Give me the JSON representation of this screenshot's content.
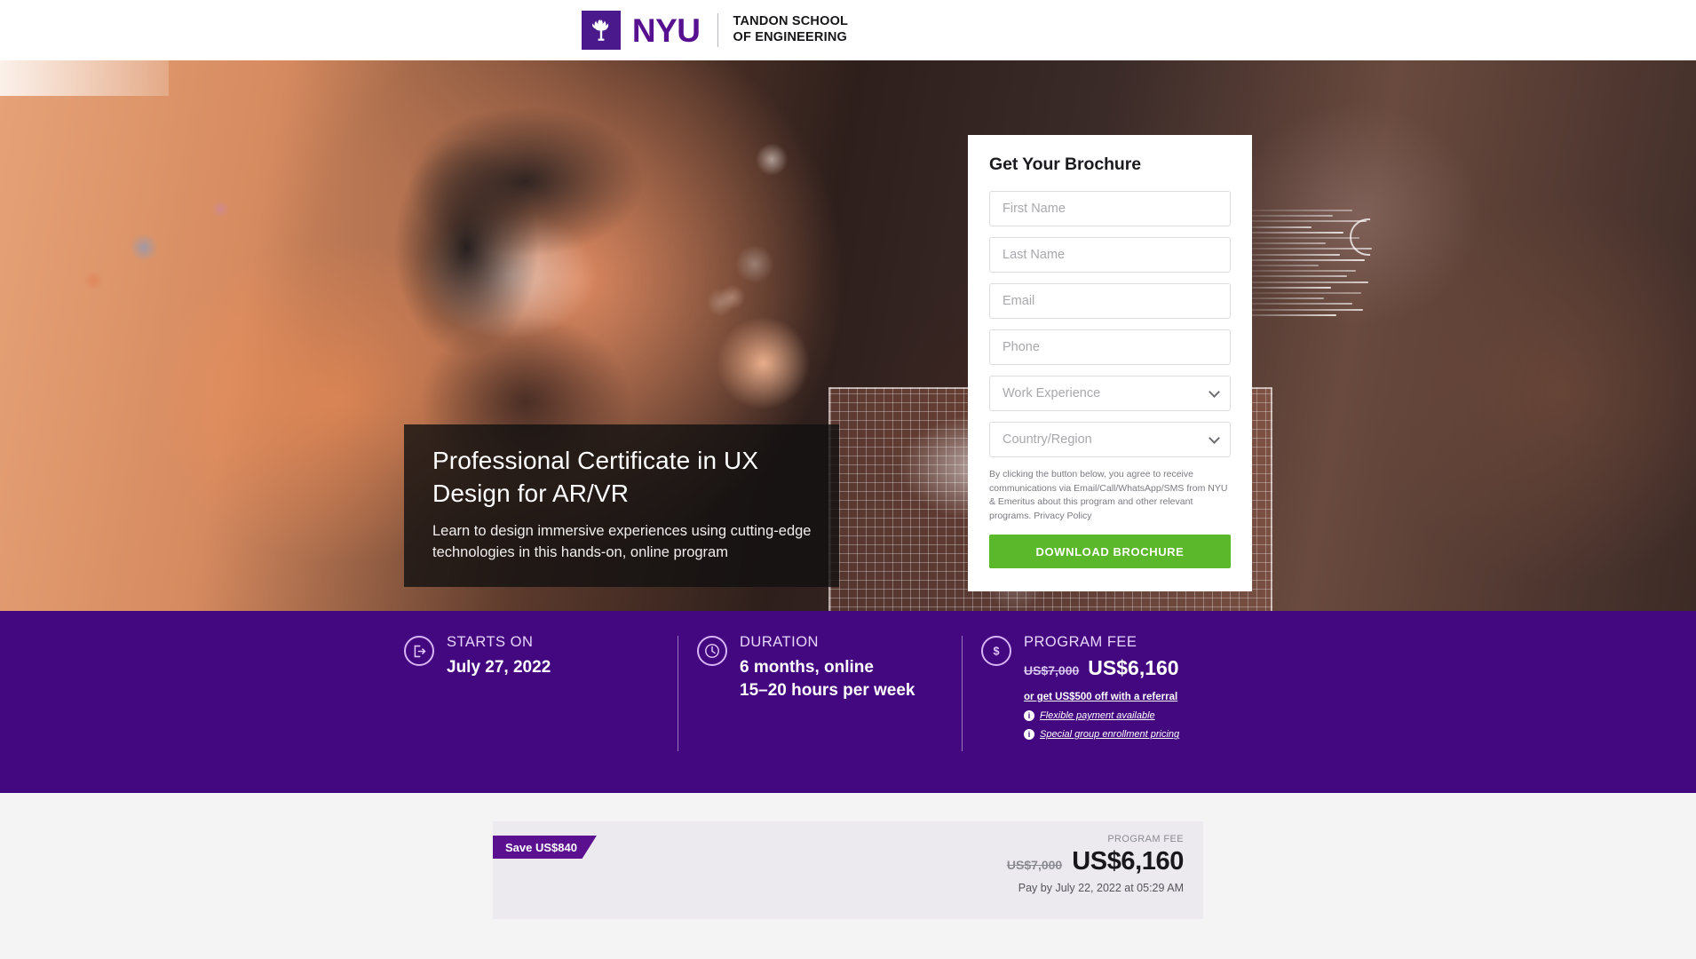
{
  "header": {
    "logo_mark_icon": "nyu-torch-icon",
    "logo_text": "NYU",
    "logo_subtitle": "TANDON SCHOOL\nOF ENGINEERING"
  },
  "hero": {
    "title": "Professional Certificate in UX Design for AR/VR",
    "subtitle": "Learn to design immersive experiences using cutting-edge technologies in this hands-on, online program"
  },
  "form": {
    "title": "Get Your Brochure",
    "fields": [
      {
        "name": "first-name",
        "placeholder": "First Name",
        "value": ""
      },
      {
        "name": "last-name",
        "placeholder": "Last Name",
        "value": ""
      },
      {
        "name": "email",
        "placeholder": "Email",
        "value": ""
      },
      {
        "name": "phone",
        "placeholder": "Phone",
        "value": ""
      }
    ],
    "selects": [
      {
        "name": "work-experience",
        "placeholder": "Work Experience",
        "value": "Work Experience"
      },
      {
        "name": "country-region",
        "placeholder": "Country/Region",
        "value": "Country/Region"
      }
    ],
    "legal_text": "By clicking the button below, you agree to receive communications via Email/Call/WhatsApp/SMS from NYU & Emeritus about this program and other relevant programs. ",
    "privacy_link": "Privacy Policy",
    "submit_label": "DOWNLOAD BROCHURE",
    "submit_color": "#5cb82b"
  },
  "infobar": {
    "background_color": "#430780",
    "starts_on": {
      "icon": "calendar-enter-icon",
      "label": "STARTS ON",
      "value": "July 27, 2022"
    },
    "duration": {
      "icon": "clock-icon",
      "label": "DURATION",
      "line1": "6 months, online",
      "line2": "15–20 hours per week"
    },
    "program_fee": {
      "icon": "dollar-icon",
      "label": "PROGRAM FEE",
      "old_price": "US$7,000",
      "new_price": "US$6,160",
      "referral_link": "or get US$500 off with a referral",
      "notes": [
        "Flexible payment available",
        "Special group enrollment pricing"
      ]
    }
  },
  "price_card": {
    "ribbon_label": "Save US$840",
    "ribbon_color": "#5a108f",
    "fee_label": "PROGRAM FEE",
    "old_price": "US$7,000",
    "new_price": "US$6,160",
    "pay_by": "Pay by July 22, 2022 at 05:29 AM"
  }
}
